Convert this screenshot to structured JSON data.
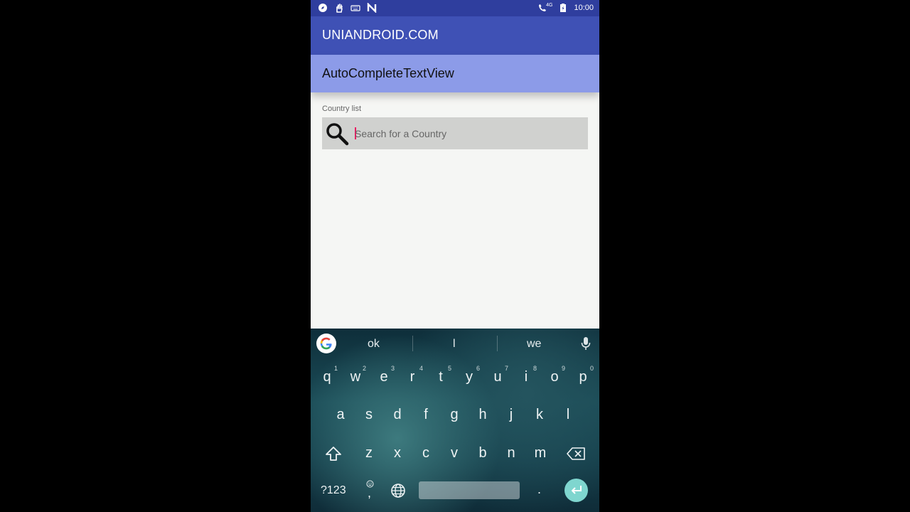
{
  "status_bar": {
    "time": "10:00",
    "network": "4G"
  },
  "app_bar": {
    "title": "UNIANDROID.COM"
  },
  "sub_bar": {
    "title": "AutoCompleteTextView"
  },
  "form": {
    "label": "Country list",
    "placeholder": "Search for a Country",
    "value": ""
  },
  "keyboard": {
    "suggestions": [
      "ok",
      "l",
      "we"
    ],
    "row1": [
      {
        "k": "q",
        "h": "1"
      },
      {
        "k": "w",
        "h": "2"
      },
      {
        "k": "e",
        "h": "3"
      },
      {
        "k": "r",
        "h": "4"
      },
      {
        "k": "t",
        "h": "5"
      },
      {
        "k": "y",
        "h": "6"
      },
      {
        "k": "u",
        "h": "7"
      },
      {
        "k": "i",
        "h": "8"
      },
      {
        "k": "o",
        "h": "9"
      },
      {
        "k": "p",
        "h": "0"
      }
    ],
    "row2": [
      "a",
      "s",
      "d",
      "f",
      "g",
      "h",
      "j",
      "k",
      "l"
    ],
    "row3": [
      "z",
      "x",
      "c",
      "v",
      "b",
      "n",
      "m"
    ],
    "symbols_label": "?123",
    "comma": ",",
    "period": "."
  },
  "colors": {
    "primary_dark": "#2f3e9e",
    "primary": "#3f51b5",
    "light_accent": "#8c9be8",
    "caret": "#e91e63",
    "enter_key": "#7fd6cf"
  }
}
